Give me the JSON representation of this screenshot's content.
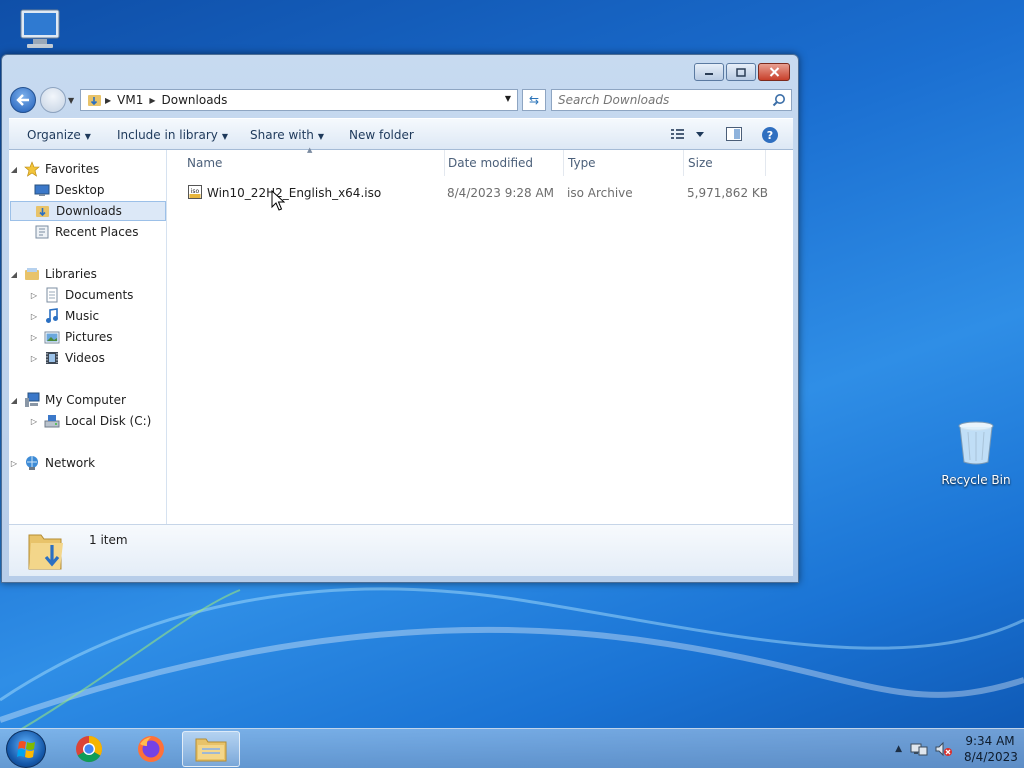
{
  "desktop": {
    "recycle_bin_label": "Recycle Bin"
  },
  "window": {
    "address": {
      "crumbs": [
        "VM1",
        "Downloads"
      ]
    },
    "search": {
      "placeholder": "Search Downloads"
    },
    "toolbar": {
      "organize": "Organize",
      "include_in_library": "Include in library",
      "share_with": "Share with",
      "new_folder": "New folder"
    },
    "nav": {
      "favorites": "Favorites",
      "desktop": "Desktop",
      "downloads": "Downloads",
      "recent_places": "Recent Places",
      "libraries": "Libraries",
      "documents": "Documents",
      "music": "Music",
      "pictures": "Pictures",
      "videos": "Videos",
      "my_computer": "My Computer",
      "local_disk": "Local Disk (C:)",
      "network": "Network"
    },
    "columns": {
      "name": "Name",
      "date_modified": "Date modified",
      "type": "Type",
      "size": "Size"
    },
    "files": [
      {
        "name": "Win10_22H2_English_x64.iso",
        "date_modified": "8/4/2023 9:28 AM",
        "type": "iso Archive",
        "size": "5,971,862 KB"
      }
    ],
    "details": {
      "item_count": "1 item"
    }
  },
  "taskbar": {
    "clock_time": "9:34 AM",
    "clock_date": "8/4/2023"
  },
  "colors": {
    "selection_bg": "#dce8f7",
    "selection_border": "#9cc0e8",
    "header_text": "#4c607a"
  }
}
